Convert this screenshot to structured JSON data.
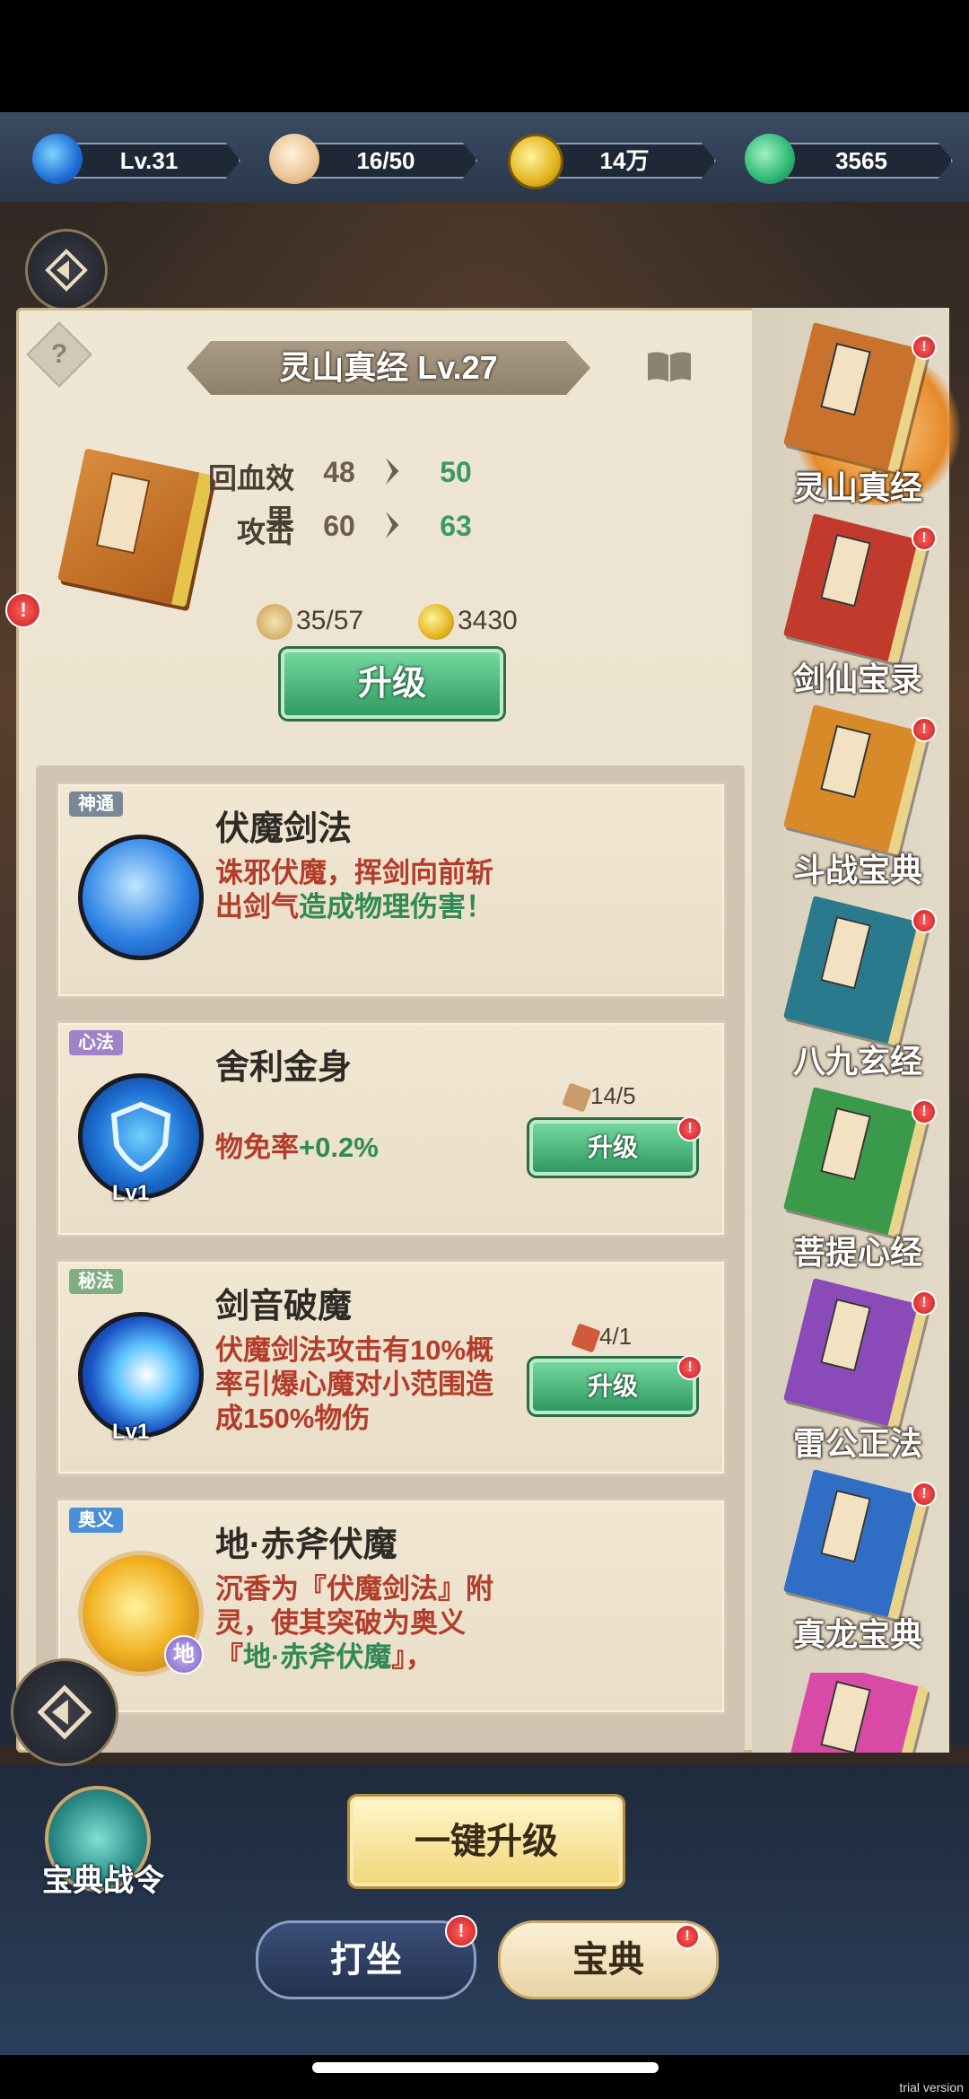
{
  "resources": [
    {
      "icon": "lv-dragon-icon",
      "value": "Lv.31"
    },
    {
      "icon": "bun-stamina-icon",
      "value": "16/50"
    },
    {
      "icon": "copper-coin-icon",
      "value": "14万"
    },
    {
      "icon": "jade-gem-icon",
      "value": "3565"
    }
  ],
  "header": {
    "help_label": "?",
    "title": "灵山真经 Lv.27"
  },
  "stats": [
    {
      "name": "回血效果",
      "current": "48",
      "next": "50"
    },
    {
      "name": "攻击",
      "current": "60",
      "next": "63"
    }
  ],
  "cost": {
    "fragments": "35/57",
    "coins": "3430"
  },
  "upgrade_label": "升级",
  "skills": [
    {
      "tag": "神通",
      "tag_color": "#7a8797",
      "name": "伏魔剑法",
      "desc_red": "诛邪伏魔，挥剑向前斩出剑气",
      "desc_green": "造成物理伤",
      "desc_tail": "害！",
      "level": ""
    },
    {
      "tag": "心法",
      "tag_color": "#a082c8",
      "name": "舍利金身",
      "desc_red": "物免率",
      "desc_green": "+0.2%",
      "level": "Lv1",
      "fragment_count": "14/5",
      "button": "升级"
    },
    {
      "tag": "秘法",
      "tag_color": "#7fae82",
      "name": "剑音破魔",
      "desc_red": "伏魔剑法攻击有10%概率引爆心魔对小范围造成150%物伤",
      "level": "Lv1",
      "fragment_count": "4/1",
      "button": "升级"
    },
    {
      "tag": "奥义",
      "tag_color": "#4b8fd6",
      "name": "地·赤斧伏魔",
      "desc_red_1": "沉香为『伏魔剑法』附灵，使其突破为奥义『",
      "desc_green": "地·赤斧伏魔",
      "desc_red_2": "』，",
      "badge": "地"
    }
  ],
  "sidebar": [
    {
      "name": "灵山真经",
      "label": "灵山",
      "color": "#c9722d",
      "active": true
    },
    {
      "name": "剑仙宝录",
      "label": "剑仙",
      "color": "#c13a2c",
      "active": false
    },
    {
      "name": "斗战宝典",
      "label": "斗战",
      "color": "#d98a28",
      "active": false
    },
    {
      "name": "八九玄经",
      "label": "八九",
      "color": "#2a7a8e",
      "active": false
    },
    {
      "name": "菩提心经",
      "label": "菩提",
      "color": "#3a9a4a",
      "active": false
    },
    {
      "name": "雷公正法",
      "label": "雷公",
      "color": "#8a4ab8",
      "active": false
    },
    {
      "name": "真龙宝典",
      "label": "真龙",
      "color": "#2f6ec4",
      "active": false
    },
    {
      "name": "",
      "label": "",
      "color": "#d94aa6",
      "active": false
    }
  ],
  "bottom": {
    "one_key_upgrade": "一键升级",
    "battle_pass": "宝典战令",
    "tab_meditate": "打坐",
    "tab_codex": "宝典"
  },
  "watermark": "trial version"
}
